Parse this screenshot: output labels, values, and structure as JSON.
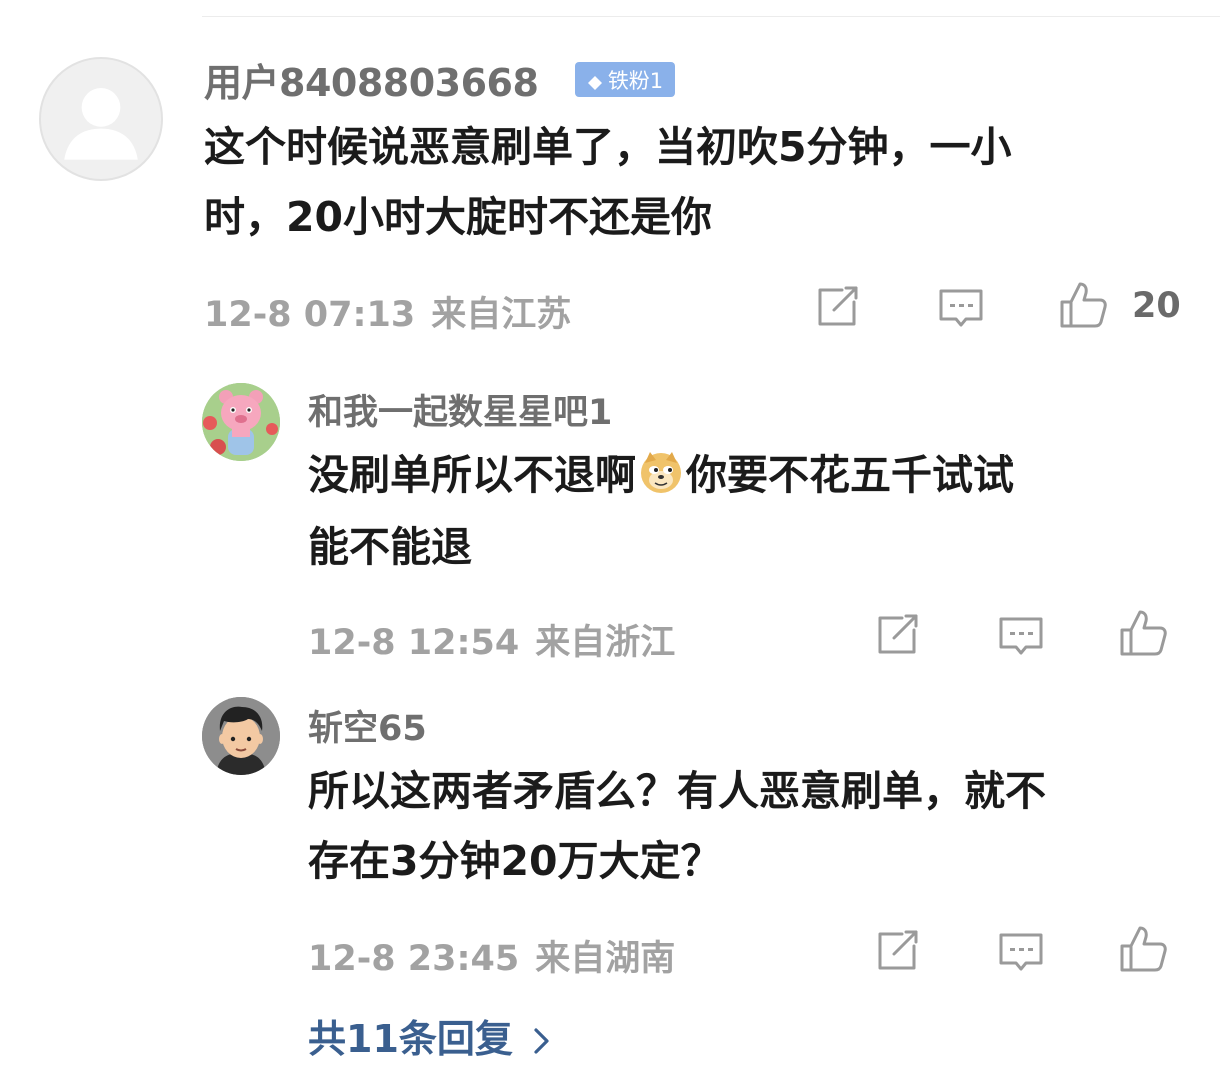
{
  "main_comment": {
    "username": "用户8408803668",
    "badge": "铁粉1",
    "text_line1": "这个时候说恶意刷单了，当初吹5分钟，一小",
    "text_line2": "时，20小时大腚时不还是你",
    "time": "12-8 07:13",
    "location": "来自江苏",
    "like_count": "20"
  },
  "replies": [
    {
      "username": "和我一起数星星吧1",
      "text_before_emoji": "没刷单所以不退啊",
      "emoji": "doge-emoji",
      "text_after_emoji": "你要不花五千试试",
      "text_line2": "能不能退",
      "time": "12-8 12:54",
      "location": "来自浙江"
    },
    {
      "username": "斩空65",
      "text_line1": "所以这两者矛盾么？有人恶意刷单，就不",
      "text_line2": "存在3分钟20万大定？",
      "time": "12-8 23:45",
      "location": "来自湖南"
    }
  ],
  "footer": {
    "replies_label": "共11条回复"
  },
  "icons": {
    "share": "share-icon",
    "comment": "comment-icon",
    "like": "like-icon",
    "chevron": "chevron-right-icon",
    "badge": "diamond-icon"
  },
  "colors": {
    "link": "#3a5f8f",
    "badge_bg": "#8ab1ea",
    "meta": "#a2a2a2"
  }
}
